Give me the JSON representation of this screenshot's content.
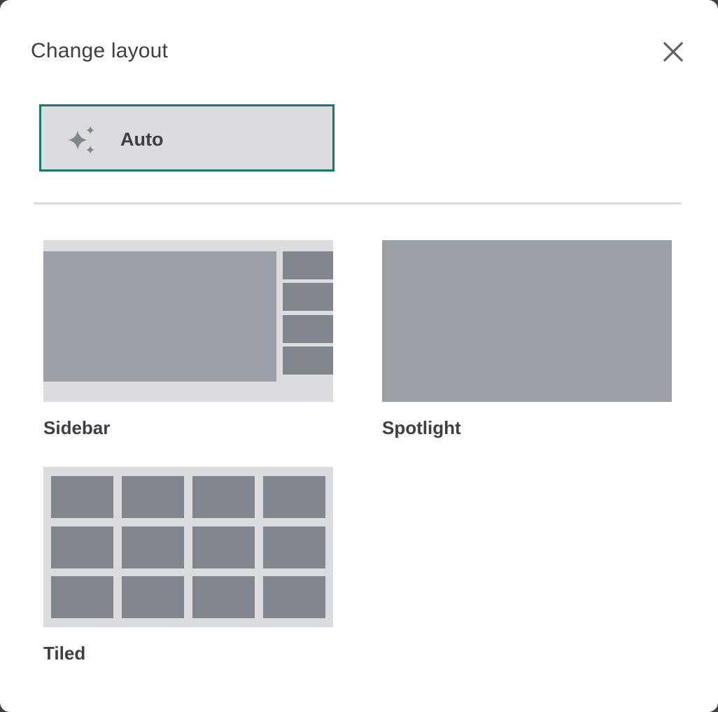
{
  "dialog": {
    "title": "Change layout",
    "close_icon": "close-icon"
  },
  "auto": {
    "label": "Auto",
    "icon": "sparkle-icon",
    "selected": true
  },
  "layouts": [
    {
      "id": "sidebar",
      "label": "Sidebar"
    },
    {
      "id": "spotlight",
      "label": "Spotlight"
    },
    {
      "id": "tiled",
      "label": "Tiled"
    }
  ],
  "colors": {
    "selected_border": "#137a6e",
    "option_bg": "#dadce0",
    "tile_dark": "#80868b",
    "tile_light": "#9aa0a6",
    "text": "#3c4043"
  }
}
